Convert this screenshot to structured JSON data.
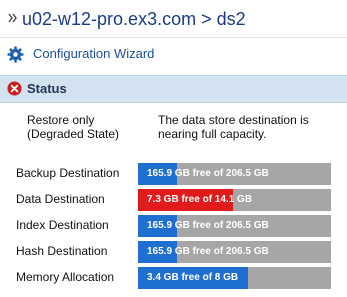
{
  "header": {
    "breadcrumb": "u02-w12-pro.ex3.com > ds2"
  },
  "wizard": {
    "label": "Configuration Wizard",
    "icon": "gear-icon"
  },
  "status": {
    "title": "Status",
    "icon": "error-icon",
    "state_label": "Restore only (Degraded State)",
    "message": "The data store destination is nearing full capacity."
  },
  "colors": {
    "normal_fill": "#1f6fd1",
    "warning_fill": "#e11b1b",
    "bar_background": "#a6a6a6"
  },
  "rows": [
    {
      "label": "Backup Destination",
      "bar_text": "165.9 GB free of 206.5 GB",
      "used_fraction": 0.2,
      "danger": false
    },
    {
      "label": "Data Destination",
      "bar_text": "7.3 GB free of 14.1 GB",
      "used_fraction": 0.49,
      "danger": true
    },
    {
      "label": "Index Destination",
      "bar_text": "165.9 GB free of 206.5 GB",
      "used_fraction": 0.2,
      "danger": false
    },
    {
      "label": "Hash Destination",
      "bar_text": "165.9 GB free of 206.5 GB",
      "used_fraction": 0.2,
      "danger": false
    },
    {
      "label": "Memory Allocation",
      "bar_text": "3.4 GB free of 8 GB",
      "used_fraction": 0.57,
      "danger": false
    }
  ]
}
